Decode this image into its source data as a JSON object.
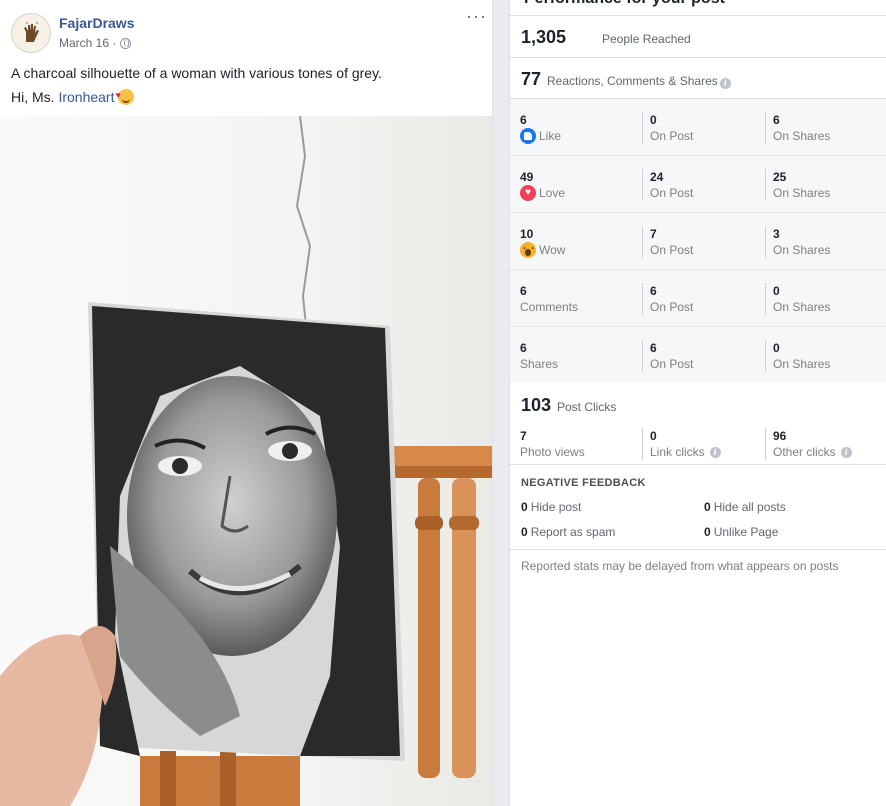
{
  "post": {
    "page_name": "FajarDraws",
    "date": "March 16 ·",
    "caption_line1": "A charcoal silhouette of a woman with various tones of grey.",
    "caption_line2_prefix": "Hi, Ms. ",
    "caption_line2_link": "Ironheart",
    "more_label": "···"
  },
  "insights": {
    "title": "Performance for your post",
    "reached": {
      "value": "1,305",
      "label": "People Reached"
    },
    "engagement": {
      "value": "77",
      "label": "Reactions, Comments & Shares"
    },
    "rows": [
      {
        "icon": "like-reaction-icon",
        "total": "6",
        "label": "Like",
        "on_post": "0",
        "on_post_label": "On Post",
        "on_shares": "6",
        "on_shares_label": "On Shares"
      },
      {
        "icon": "love-reaction-icon",
        "total": "49",
        "label": "Love",
        "on_post": "24",
        "on_post_label": "On Post",
        "on_shares": "25",
        "on_shares_label": "On Shares"
      },
      {
        "icon": "wow-reaction-icon",
        "total": "10",
        "label": "Wow",
        "on_post": "7",
        "on_post_label": "On Post",
        "on_shares": "3",
        "on_shares_label": "On Shares"
      },
      {
        "icon": "",
        "total": "6",
        "label": "Comments",
        "on_post": "6",
        "on_post_label": "On Post",
        "on_shares": "0",
        "on_shares_label": "On Shares"
      },
      {
        "icon": "",
        "total": "6",
        "label": "Shares",
        "on_post": "6",
        "on_post_label": "On Post",
        "on_shares": "0",
        "on_shares_label": "On Shares"
      }
    ],
    "clicks": {
      "value": "103",
      "label": "Post Clicks",
      "photo_views": "7",
      "photo_views_label": "Photo views",
      "link_clicks": "0",
      "link_clicks_label": "Link clicks",
      "other_clicks": "96",
      "other_clicks_label": "Other clicks"
    },
    "negative": {
      "title": "NEGATIVE FEEDBACK",
      "hide_post": "0",
      "hide_post_label": "Hide post",
      "hide_all": "0",
      "hide_all_label": "Hide all posts",
      "spam": "0",
      "spam_label": "Report as spam",
      "unlike": "0",
      "unlike_label": "Unlike Page"
    },
    "disclaimer": "Reported stats may be delayed from what appears on posts"
  },
  "colors": {
    "link": "#385898",
    "like": "#1877f2",
    "love": "#f33e58",
    "wow": "#f7b125"
  }
}
